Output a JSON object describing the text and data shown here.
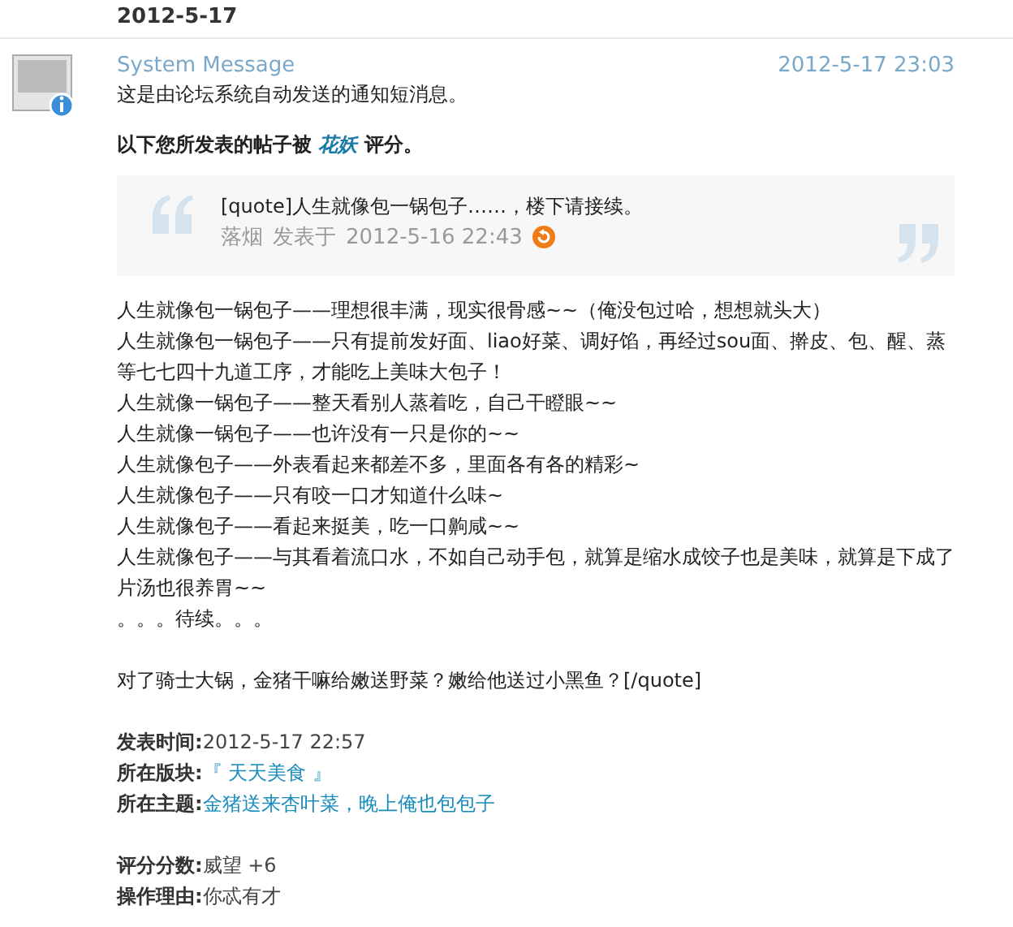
{
  "date_header": "2012-5-17",
  "message": {
    "sender": "System Message",
    "time": "2012-5-17 23:03",
    "intro": "这是由论坛系统自动发送的通知短消息。",
    "notice": "以下您所发表的帖子被 ",
    "rater": "花妖",
    "notice_end": " 评分。",
    "quote": {
      "text": "[quote]人生就像包一锅包子……，楼下请接续。",
      "author": "落烟",
      "posted_label": "发表于",
      "posted_time": "2012-5-16 22:43"
    },
    "body": [
      "人生就像包一锅包子——理想很丰满，现实很骨感~~（俺没包过哈，想想就头大）",
      "人生就像包一锅包子——只有提前发好面、liao好菜、调好馅，再经过sou面、擀皮、包、醒、蒸等七七四十九道工序，才能吃上美味大包子！",
      "人生就像一锅包子——整天看别人蒸着吃，自己干瞪眼~~",
      "人生就像一锅包子——也许没有一只是你的~~",
      "人生就像包子——外表看起来都差不多，里面各有各的精彩~",
      "人生就像包子——只有咬一口才知道什么味~",
      "人生就像包子——看起来挺美，吃一口齁咸~~",
      "人生就像包子——与其看着流口水，不如自己动手包，就算是缩水成饺子也是美味，就算是下成了片汤也很养胃~~",
      "。。。待续。。。"
    ],
    "closing": "对了骑士大锅，金猪干嘛给嫩送野菜？嫩给他送过小黑鱼？[/quote]",
    "meta": [
      {
        "label": "发表时间:",
        "value": "2012-5-17 22:57",
        "kind": "text"
      },
      {
        "label": "所在版块:",
        "value": "『 天天美食 』",
        "kind": "link"
      },
      {
        "label": "所在主题:",
        "value": "金猪送来杏叶菜，晚上俺也包包子",
        "kind": "link"
      }
    ],
    "rating": [
      {
        "label": "评分分数:",
        "value": "威望 +6",
        "kind": "text"
      },
      {
        "label": "操作理由:",
        "value": "你忒有才",
        "kind": "text"
      }
    ]
  }
}
